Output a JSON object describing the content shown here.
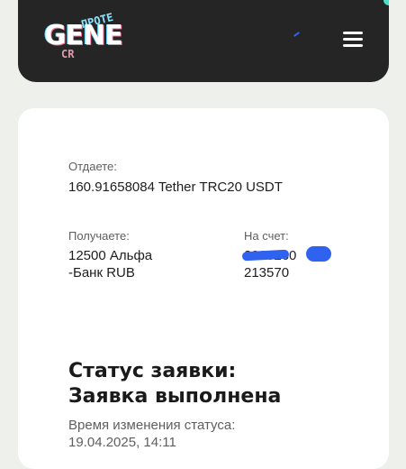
{
  "header": {
    "logo_text": "GENE",
    "logo_overlay_top": "ПРОТЕ",
    "logo_overlay_bottom": "CR",
    "logo_icon": "gene-crypto-logo",
    "menu_icon": "hamburger-menu-icon",
    "background_color": "#252525",
    "accent_color": "#49e0c6"
  },
  "exchange": {
    "give_label": "Отдаете:",
    "give_value": "160.91658084 Tether TRC20 USDT",
    "receive_label": "Получаете:",
    "receive_value_line1": "12500 Альфа",
    "receive_value_line2": "-Банк RUB",
    "account_label": "На счет:",
    "account_value_line1": "2200260",
    "account_value_line2": "213570",
    "redaction_color": "#2f62ef"
  },
  "status": {
    "title_line1": "Статус заявки:",
    "title_line2": "Заявка выполнена",
    "time_label": "Время изменения статуса:",
    "time_value": "19.04.2025, 14:11"
  }
}
